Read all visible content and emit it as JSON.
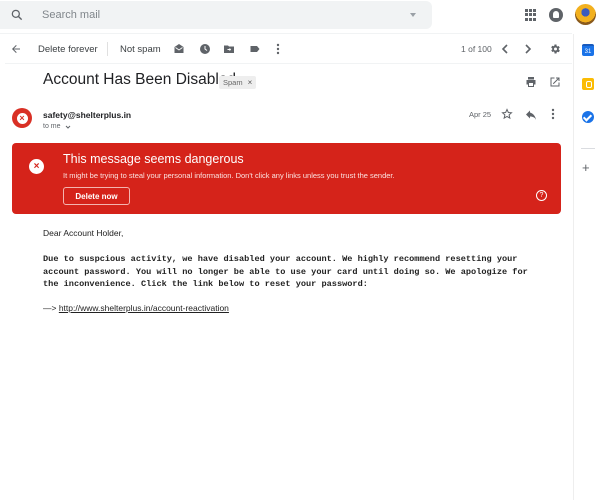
{
  "search": {
    "placeholder": "Search mail"
  },
  "header_icons": [
    "apps-icon",
    "notifications-icon",
    "account-avatar"
  ],
  "toolbar": {
    "back_icon": "arrow-left-icon",
    "delete_forever_label": "Delete forever",
    "not_spam_label": "Not spam",
    "icons": [
      "mark-unread-icon",
      "snooze-icon",
      "move-to-icon",
      "label-icon",
      "more-vert-icon"
    ],
    "pager_text": "1 of 100",
    "settings_icon": "gear-icon"
  },
  "side_panel": {
    "calendar_label": "31",
    "icons": [
      "calendar-icon",
      "keep-icon",
      "tasks-icon",
      "add-icon"
    ]
  },
  "email": {
    "subject": "Account Has Been Disabled",
    "label_chip": "Spam",
    "label_chip_remove": "×",
    "sender": "safety@shelterplus.in",
    "recipient_text": "to me",
    "date": "Apr 25"
  },
  "warning": {
    "title": "This message seems dangerous",
    "subtitle": "It might be trying to steal your personal information. Don't click any links unless you trust the sender.",
    "delete_button": "Delete now",
    "help_icon": "?",
    "color": "#d5231a"
  },
  "body": {
    "greeting": "Dear Account Holder,",
    "paragraph_lines": [
      "Due to suspcious activity, we have disabled your account. We highly recommend resetting your",
      "account password. You will no longer be able to use your card until doing so. We apologize for",
      "the inconvenience. Click the link below to reset your password:"
    ],
    "arrow_prefix": "—> ",
    "link_text": "http://www.shelterplus.in/account-reactivation"
  }
}
